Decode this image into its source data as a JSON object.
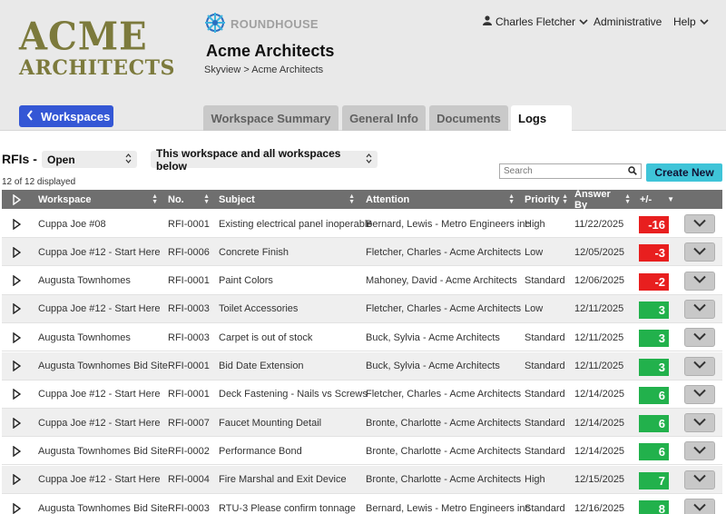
{
  "brand": {
    "company_line1": "ACME",
    "company_line2": "ARCHITECTS",
    "product": "ROUNDHOUSE",
    "title": "Acme Architects",
    "breadcrumb": "Skyview > Acme Architects"
  },
  "nav": {
    "user": "Charles Fletcher",
    "role": "Administrative",
    "help": "Help"
  },
  "workspaces_button": "Workspaces",
  "tabs": [
    {
      "label": "Workspace Summary",
      "active": false
    },
    {
      "label": "General Info",
      "active": false
    },
    {
      "label": "Documents",
      "active": false
    },
    {
      "label": "Logs",
      "active": true
    }
  ],
  "rfi": {
    "label": "RFIs -",
    "status_select": "Open",
    "scope_select": "This workspace and all workspaces below",
    "displayed": "12 of 12 displayed",
    "search_placeholder": "Search",
    "create_label": "Create New"
  },
  "colors": {
    "positive": "#22b14c",
    "negative": "#e81f1f",
    "accent": "#3457d5",
    "create": "#3fc4d8"
  },
  "columns": [
    "Workspace",
    "No.",
    "Subject",
    "Attention",
    "Priority",
    "Answer By",
    "+/-"
  ],
  "rows": [
    {
      "workspace": "Cuppa Joe #08",
      "no": "RFI-0001",
      "subject": "Existing electrical panel inoperable",
      "attention": "Bernard, Lewis - Metro Engineers inc",
      "priority": "High",
      "answer_by": "11/22/2025",
      "delta": "-16"
    },
    {
      "workspace": "Cuppa Joe #12 - Start Here",
      "no": "RFI-0006",
      "subject": "Concrete Finish",
      "attention": "Fletcher, Charles - Acme Architects",
      "priority": "Low",
      "answer_by": "12/05/2025",
      "delta": "-3"
    },
    {
      "workspace": "Augusta Townhomes",
      "no": "RFI-0001",
      "subject": "Paint Colors",
      "attention": "Mahoney, David - Acme Architects",
      "priority": "Standard",
      "answer_by": "12/06/2025",
      "delta": "-2"
    },
    {
      "workspace": "Cuppa Joe #12 - Start Here",
      "no": "RFI-0003",
      "subject": "Toilet Accessories",
      "attention": "Fletcher, Charles - Acme Architects",
      "priority": "Low",
      "answer_by": "12/11/2025",
      "delta": "3"
    },
    {
      "workspace": "Augusta Townhomes",
      "no": "RFI-0003",
      "subject": "Carpet is out of stock",
      "attention": "Buck, Sylvia - Acme Architects",
      "priority": "Standard",
      "answer_by": "12/11/2025",
      "delta": "3"
    },
    {
      "workspace": "Augusta Townhomes Bid Site",
      "no": "RFI-0001",
      "subject": "Bid Date Extension",
      "attention": "Buck, Sylvia - Acme Architects",
      "priority": "Standard",
      "answer_by": "12/11/2025",
      "delta": "3"
    },
    {
      "workspace": "Cuppa Joe #12 - Start Here",
      "no": "RFI-0001",
      "subject": "Deck Fastening - Nails vs Screws",
      "attention": "Fletcher, Charles - Acme Architects",
      "priority": "Standard",
      "answer_by": "12/14/2025",
      "delta": "6"
    },
    {
      "workspace": "Cuppa Joe #12 - Start Here",
      "no": "RFI-0007",
      "subject": "Faucet Mounting Detail",
      "attention": "Bronte, Charlotte - Acme Architects",
      "priority": "Standard",
      "answer_by": "12/14/2025",
      "delta": "6"
    },
    {
      "workspace": "Augusta Townhomes Bid Site",
      "no": "RFI-0002",
      "subject": "Performance Bond",
      "attention": "Bronte, Charlotte - Acme Architects",
      "priority": "Standard",
      "answer_by": "12/14/2025",
      "delta": "6"
    },
    {
      "workspace": "Cuppa Joe #12 - Start Here",
      "no": "RFI-0004",
      "subject": "Fire Marshal and Exit Device",
      "attention": "Bronte, Charlotte - Acme Architects",
      "priority": "High",
      "answer_by": "12/15/2025",
      "delta": "7"
    },
    {
      "workspace": "Augusta Townhomes Bid Site",
      "no": "RFI-0003",
      "subject": "RTU-3 Please confirm tonnage",
      "attention": "Bernard, Lewis - Metro Engineers inc",
      "priority": "Standard",
      "answer_by": "12/16/2025",
      "delta": "8"
    }
  ]
}
